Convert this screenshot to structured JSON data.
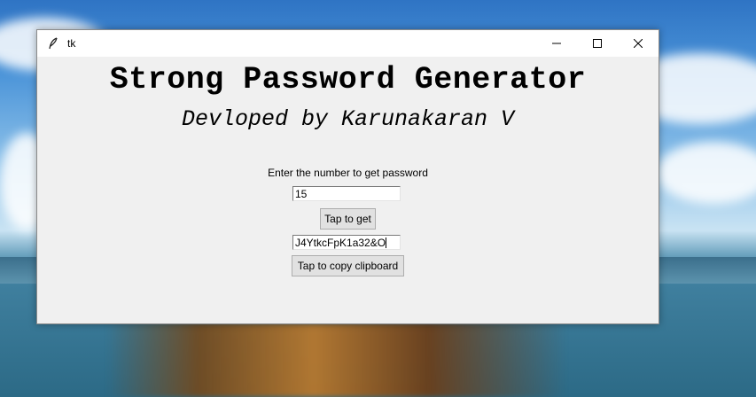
{
  "window": {
    "title": "tk"
  },
  "app": {
    "heading": "Strong Password Generator",
    "subheading": "Devloped by Karunakaran V",
    "prompt": "Enter the number to get password",
    "length_value": "15",
    "generate_label": "Tap to get",
    "password_value": "J4YtkcFpK1a32&O",
    "copy_label": "Tap to copy clipboard"
  },
  "icons": {
    "app": "feather-icon",
    "minimize": "minimize-icon",
    "maximize": "maximize-icon",
    "close": "close-icon"
  }
}
